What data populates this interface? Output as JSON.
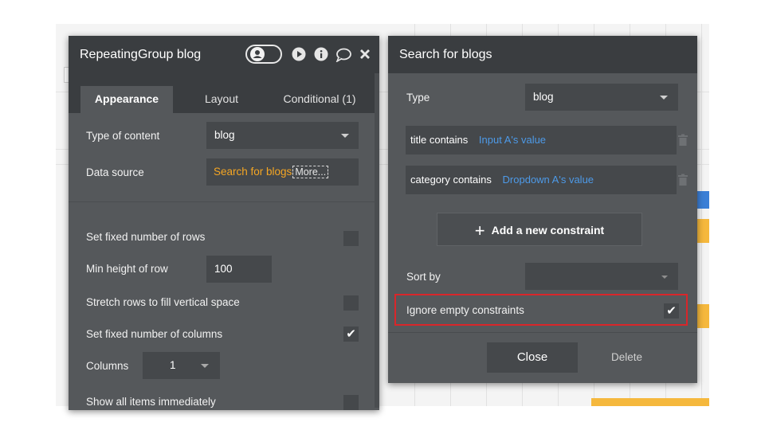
{
  "left_panel": {
    "title": "RepeatingGroup blog",
    "tabs": [
      {
        "label": "Appearance",
        "active": true
      },
      {
        "label": "Layout",
        "active": false
      },
      {
        "label": "Conditional (1)",
        "active": false
      }
    ],
    "type_of_content": {
      "label": "Type of content",
      "value": "blog"
    },
    "data_source": {
      "label": "Data source",
      "value": "Search for blogs",
      "more_label": "More..."
    },
    "set_fixed_rows": {
      "label": "Set fixed number of rows",
      "checked": false
    },
    "min_height": {
      "label": "Min height of row",
      "value": "100"
    },
    "stretch_rows": {
      "label": "Stretch rows to fill vertical space",
      "checked": false
    },
    "set_fixed_columns": {
      "label": "Set fixed number of columns",
      "checked": true
    },
    "columns": {
      "label": "Columns",
      "value": "1"
    },
    "show_all_items": {
      "label": "Show all items immediately",
      "checked": false
    }
  },
  "right_panel": {
    "title": "Search for blogs",
    "type": {
      "label": "Type",
      "value": "blog"
    },
    "constraints": [
      {
        "field": "title contains",
        "value": "Input A's value"
      },
      {
        "field": "category contains",
        "value": "Dropdown A's value"
      }
    ],
    "add_constraint_label": "Add a new constraint",
    "sort_by": {
      "label": "Sort by",
      "value": ""
    },
    "ignore_empty": {
      "label": "Ignore empty constraints",
      "checked": true
    },
    "close_label": "Close",
    "delete_label": "Delete"
  },
  "colors": {
    "panel_bg": "#55585b",
    "header_bg": "#3a3d40",
    "field_bg": "#45484b",
    "accent_orange": "#f5a623",
    "accent_blue": "#4d9ae8",
    "highlight_red": "#d9262a"
  },
  "icons": [
    "user-toggle-icon",
    "play-icon",
    "info-icon",
    "comment-icon",
    "close-icon",
    "trash-icon",
    "plus-icon",
    "checkmark-icon",
    "chevron-down-icon"
  ]
}
